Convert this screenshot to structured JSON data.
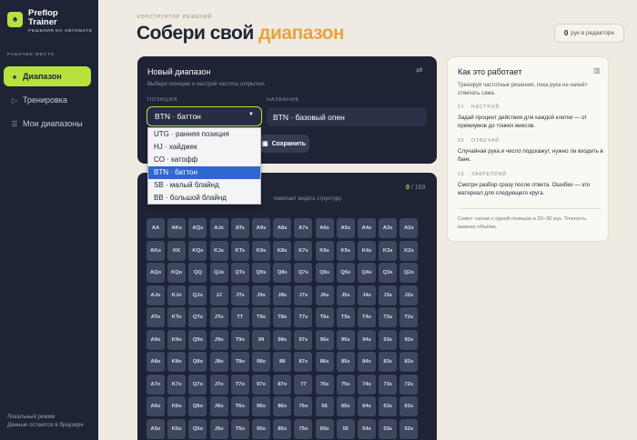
{
  "sidebar": {
    "brand_name_1": "Preflop",
    "brand_name_2": "Trainer",
    "brand_sub": "РЕШЕНИЯ НА АВТОМАТЕ",
    "section_label": "РАБОЧЕЕ МЕСТО",
    "items": [
      {
        "label": "Диапазон",
        "icon": "spade-icon",
        "active": true
      },
      {
        "label": "Тренировка",
        "icon": "play-icon",
        "active": false
      },
      {
        "label": "Мои диапазоны",
        "icon": "list-icon",
        "active": false
      }
    ],
    "footer_line1": "Локальный режим",
    "footer_line2": "Данные остаются в браузере"
  },
  "header": {
    "eyebrow": "КОНСТРУКТОР РЕШЕНИЙ",
    "title_main": "Собери свой ",
    "title_accent": "диапазон",
    "counter_value": "0",
    "counter_label": "рук в редакторе"
  },
  "editor": {
    "title": "Новый диапазон",
    "subtitle": "Выбери позицию и настрой частоты открытия.",
    "position_label": "ПОЗИЦИЯ",
    "name_label": "НАЗВАНИЕ",
    "position_value": "BTN · баттон",
    "name_value": "BTN · базовый опен",
    "save_label": "Сохранить",
    "options": [
      "UTG · ранняя позиция",
      "HJ · хайджек",
      "CO · катофф",
      "BTN · баттон",
      "SB · малый блайнд",
      "BB · большой блайнд"
    ],
    "selected_option": "BTN · баттон"
  },
  "grid": {
    "count_selected": "0",
    "count_total": "/ 169",
    "subtitle": "помогает видеть структуру.",
    "rows": [
      [
        "AA",
        "AKs",
        "AQs",
        "AJs",
        "ATs",
        "A9s",
        "A8s",
        "A7s",
        "A6s",
        "A5s",
        "A4s",
        "A3s",
        "A2s"
      ],
      [
        "AKo",
        "KK",
        "KQs",
        "KJs",
        "KTs",
        "K9s",
        "K8s",
        "K7s",
        "K6s",
        "K5s",
        "K4s",
        "K3s",
        "K2s"
      ],
      [
        "AQo",
        "KQo",
        "QQ",
        "QJs",
        "QTs",
        "Q9s",
        "Q8s",
        "Q7s",
        "Q6s",
        "Q5s",
        "Q4s",
        "Q3s",
        "Q2s"
      ],
      [
        "AJo",
        "KJo",
        "QJo",
        "JJ",
        "JTs",
        "J9s",
        "J8s",
        "J7s",
        "J6s",
        "J5s",
        "J4s",
        "J3s",
        "J2s"
      ],
      [
        "ATo",
        "KTo",
        "QTo",
        "JTo",
        "TT",
        "T9s",
        "T8s",
        "T7s",
        "T6s",
        "T5s",
        "T4s",
        "T3s",
        "T2s"
      ],
      [
        "A9o",
        "K9o",
        "Q9o",
        "J9o",
        "T9o",
        "99",
        "98s",
        "97s",
        "96s",
        "95s",
        "94s",
        "93s",
        "92s"
      ],
      [
        "A8o",
        "K8o",
        "Q8o",
        "J8o",
        "T8o",
        "98o",
        "88",
        "87s",
        "86s",
        "85s",
        "84s",
        "83s",
        "82s"
      ],
      [
        "A7o",
        "K7o",
        "Q7o",
        "J7o",
        "T7o",
        "97o",
        "87o",
        "77",
        "76s",
        "75s",
        "74s",
        "73s",
        "72s"
      ],
      [
        "A6o",
        "K6o",
        "Q6o",
        "J6o",
        "T6o",
        "96o",
        "86o",
        "76o",
        "66",
        "65s",
        "64s",
        "63s",
        "62s"
      ],
      [
        "A5o",
        "K5o",
        "Q5o",
        "J5o",
        "T5o",
        "95o",
        "85o",
        "75o",
        "65o",
        "55",
        "54s",
        "53s",
        "52s"
      ]
    ]
  },
  "info": {
    "title": "Как это работает",
    "subtitle": "Тренируй частотные решения, пока рука не начнёт отвечать сама.",
    "steps": [
      {
        "label": "01 · НАСТРОЙ",
        "text": "Задай процент действия для каждой клетки — от премиумов до тонких миксов."
      },
      {
        "label": "02 · ОТВЕЧАЙ",
        "text": "Случайная рука и число подскажут, нужно ли входить в банк."
      },
      {
        "label": "03 · ЗАКРЕПЛЯЙ",
        "text": "Смотри разбор сразу после ответа. Ошибки — это материал для следующего круга."
      }
    ],
    "footer": "Совет: начни с одной позиции и 20–30 рук. Точность важнее объёма."
  },
  "colors": {
    "accent": "#b7e23b",
    "title_accent": "#e8a33d",
    "sidebar_bg": "#1e2335",
    "page_bg": "#efebe3",
    "selected_option": "#2f66d0"
  }
}
